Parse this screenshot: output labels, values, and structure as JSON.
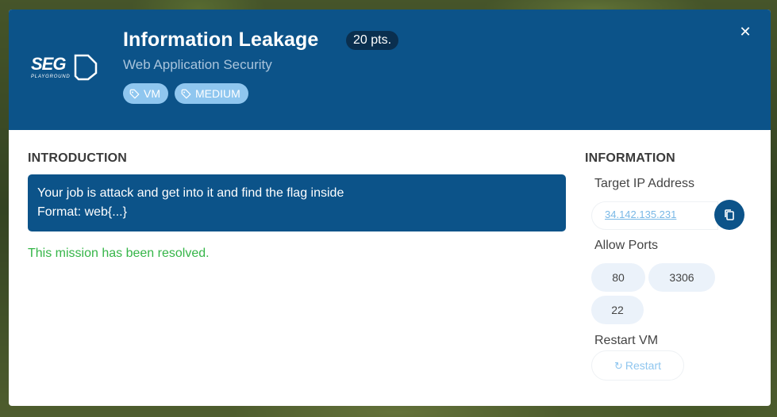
{
  "header": {
    "title": "Information Leakage",
    "points": "20 pts.",
    "subtitle": "Web Application Security",
    "tags": [
      "VM",
      "MEDIUM"
    ],
    "close_glyph": "✕",
    "logo_text": "SEG",
    "logo_subtext": "PLAYGROUND"
  },
  "introduction": {
    "heading": "INTRODUCTION",
    "lines": [
      "Your job is attack and get into it and find the flag inside",
      "Format: web{...}"
    ],
    "status": "This mission has been resolved."
  },
  "information": {
    "heading": "INFORMATION",
    "target_ip_label": "Target IP Address",
    "target_ip": "34.142.135.231",
    "ports_label": "Allow Ports",
    "ports": [
      "80",
      "3306",
      "22"
    ],
    "restart_label": "Restart VM",
    "restart_button": "Restart",
    "restart_icon": "↻"
  },
  "icons": {
    "tag": "tag-icon",
    "copy": "copy-icon",
    "close": "close-icon",
    "restart": "refresh-icon"
  },
  "colors": {
    "header_bg": "#0c5389",
    "badge_bg": "#0a2f4f",
    "tag_bg": "#8fc6ef",
    "success": "#35b548",
    "link": "#79b8e6",
    "chip_bg": "#ebf2fa"
  }
}
